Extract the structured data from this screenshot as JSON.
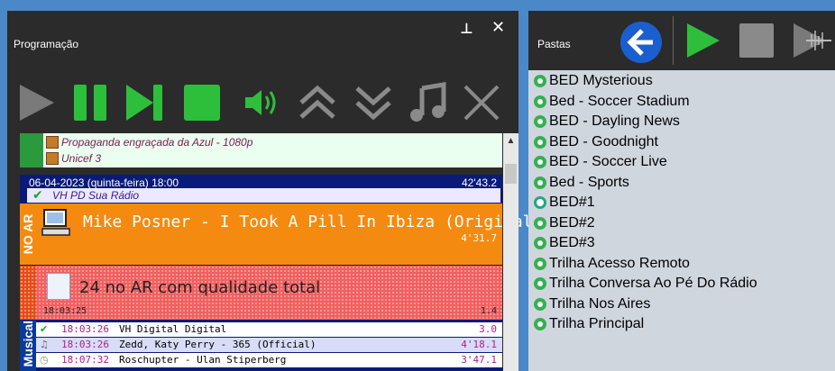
{
  "colors": {
    "accent_green": "#2dbf3c",
    "onair_orange": "#f58a10",
    "promo_red": "#f06060",
    "dark_bg": "#2b2b2b"
  },
  "left_panel": {
    "title": "Programação",
    "pin_icon": "pin-icon",
    "close_icon": "close-icon",
    "toolbar": [
      "play-icon",
      "pause-icon",
      "skip-next-icon",
      "stop-icon",
      "volume-icon",
      "move-up-icon",
      "move-down-icon",
      "music-note-icon",
      "delete-icon"
    ],
    "completed_rows": [
      {
        "title": "Propaganda engraçada da Azul - 1080p"
      },
      {
        "title": "Unicef 3"
      }
    ],
    "block": {
      "header": "06-04-2023 (quinta-feira) 18:00",
      "duration": "42'43.2",
      "vh_row": "VH PD Sua Rádio",
      "on_air_label": "NO AR",
      "on_air_title": "Mike Posner - I Took A Pill In Ibiza (Original)",
      "on_air_duration": "4'31.7",
      "promo_title": "24 no AR com qualidade total",
      "promo_time": "18:03:25",
      "promo_value": "1.4",
      "music_label": "Musical",
      "tracks": [
        {
          "time": "18:03:26",
          "title": "VH Digital Digital",
          "duration": "3.0"
        },
        {
          "time": "18:03:26",
          "title": "Zedd, Katy Perry - 365 (Official)",
          "duration": "4'18.1"
        },
        {
          "time": "18:07:32",
          "title": "Roschupter - Ulan Stiperberg",
          "duration": "3'47.1"
        }
      ]
    }
  },
  "right_panel": {
    "title": "Pastas",
    "folders": [
      "BED  Mysterious",
      "Bed -  Soccer Stadium",
      "BED - Dayling News",
      "BED - Goodnight",
      "BED - Soccer  Live",
      "Bed - Sports",
      "BED#1",
      "BED#2",
      "BED#3",
      "Trilha Acesso Remoto",
      "Trilha Conversa Ao Pé Do Rádio",
      "Trilha Nos Aires",
      "Trilha Principal"
    ]
  }
}
